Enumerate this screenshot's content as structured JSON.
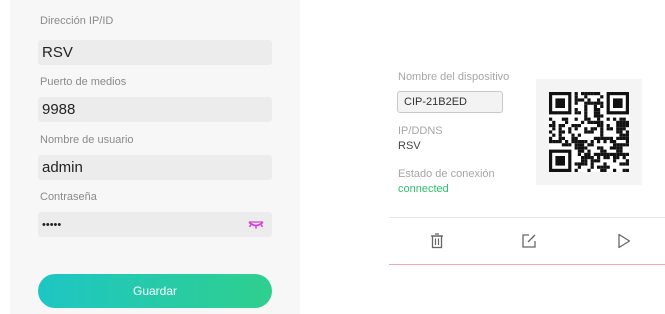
{
  "form": {
    "ip_label": "Dirección IP/ID",
    "ip_value": "RSV",
    "port_label": "Puerto de medios",
    "port_value": "9988",
    "user_label": "Nombre de usuario",
    "user_value": "admin",
    "password_label": "Contraseña",
    "password_value": "•••••",
    "save_label": "Guardar"
  },
  "device": {
    "name_label": "Nombre del dispositivo",
    "name_value": "CIP-21B2ED",
    "ip_label": "IP/DDNS",
    "ip_value": "RSV",
    "status_label": "Estado de conexión",
    "status_value": "connected"
  },
  "icons": {
    "eye": "eye-closed-icon",
    "delete": "trash-icon",
    "edit": "edit-icon",
    "play": "play-icon",
    "qr": "qr-code"
  },
  "colors": {
    "accent_start": "#1ec6c4",
    "accent_end": "#2fcf8e",
    "status_ok": "#2fbf6a",
    "eye_icon": "#d63cd6"
  }
}
